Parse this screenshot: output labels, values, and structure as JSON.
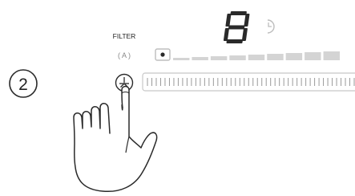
{
  "step": {
    "number": "2"
  },
  "filter": {
    "label": "FILTER",
    "auto_label": "( A )"
  },
  "display": {
    "digit": "8"
  },
  "icons": {
    "step": "circled-number-icon",
    "timer": "timer-icon",
    "power_level_indicator": "dot-icon",
    "power_button": "power-icon",
    "hand": "hand-pointing-icon"
  },
  "level_bar": {
    "segments": 9
  },
  "slider": {
    "ticks": 48
  },
  "colors": {
    "stroke": "#2a2a2a",
    "light": "#d4d4d4",
    "text": "#222222",
    "muted": "#888888",
    "background": "#ffffff"
  }
}
